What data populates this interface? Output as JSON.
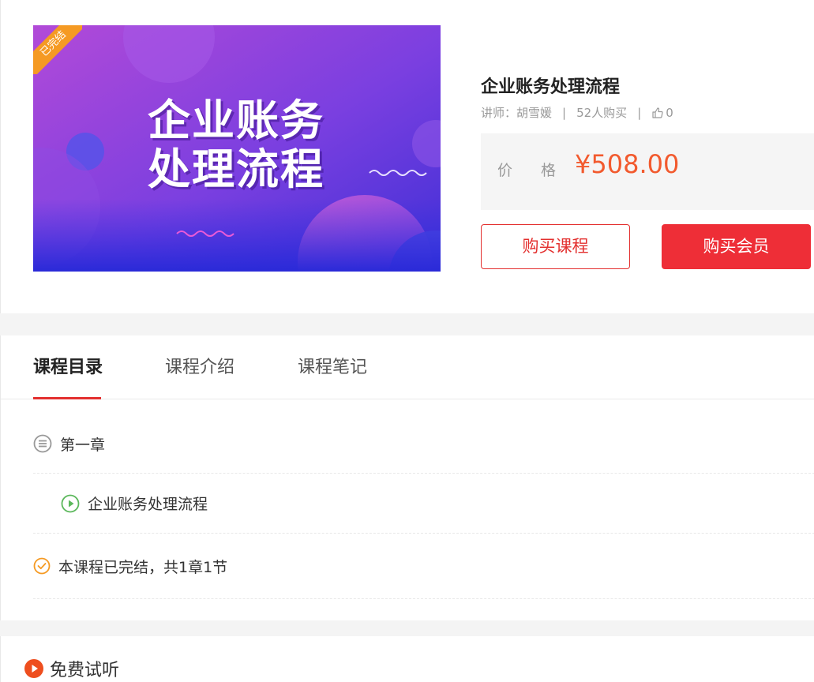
{
  "cover": {
    "title_line1": "企业账务",
    "title_line2": "处理流程",
    "badge": "已完结"
  },
  "course": {
    "title": "企业账务处理流程",
    "teacher_label": "讲师：",
    "teacher_name": "胡雪媛",
    "sep": "|",
    "buyers": "52人购买",
    "likes": "0"
  },
  "price": {
    "label_a": "价",
    "label_b": "格",
    "value": "¥508.00"
  },
  "buttons": {
    "buy_course": "购买课程",
    "buy_member": "购买会员"
  },
  "tabs": [
    {
      "label": "课程目录",
      "active": true
    },
    {
      "label": "课程介绍",
      "active": false
    },
    {
      "label": "课程笔记",
      "active": false
    }
  ],
  "catalog": {
    "chapter": "第一章",
    "lesson": "企业账务处理流程",
    "summary": "本课程已完结，共1章1节"
  },
  "free_trial": {
    "label": "免费试听"
  },
  "colors": {
    "accent_red": "#e3302f",
    "price_orange": "#f25a2e",
    "play_green": "#5cb85c",
    "check_orange": "#f59a23"
  }
}
